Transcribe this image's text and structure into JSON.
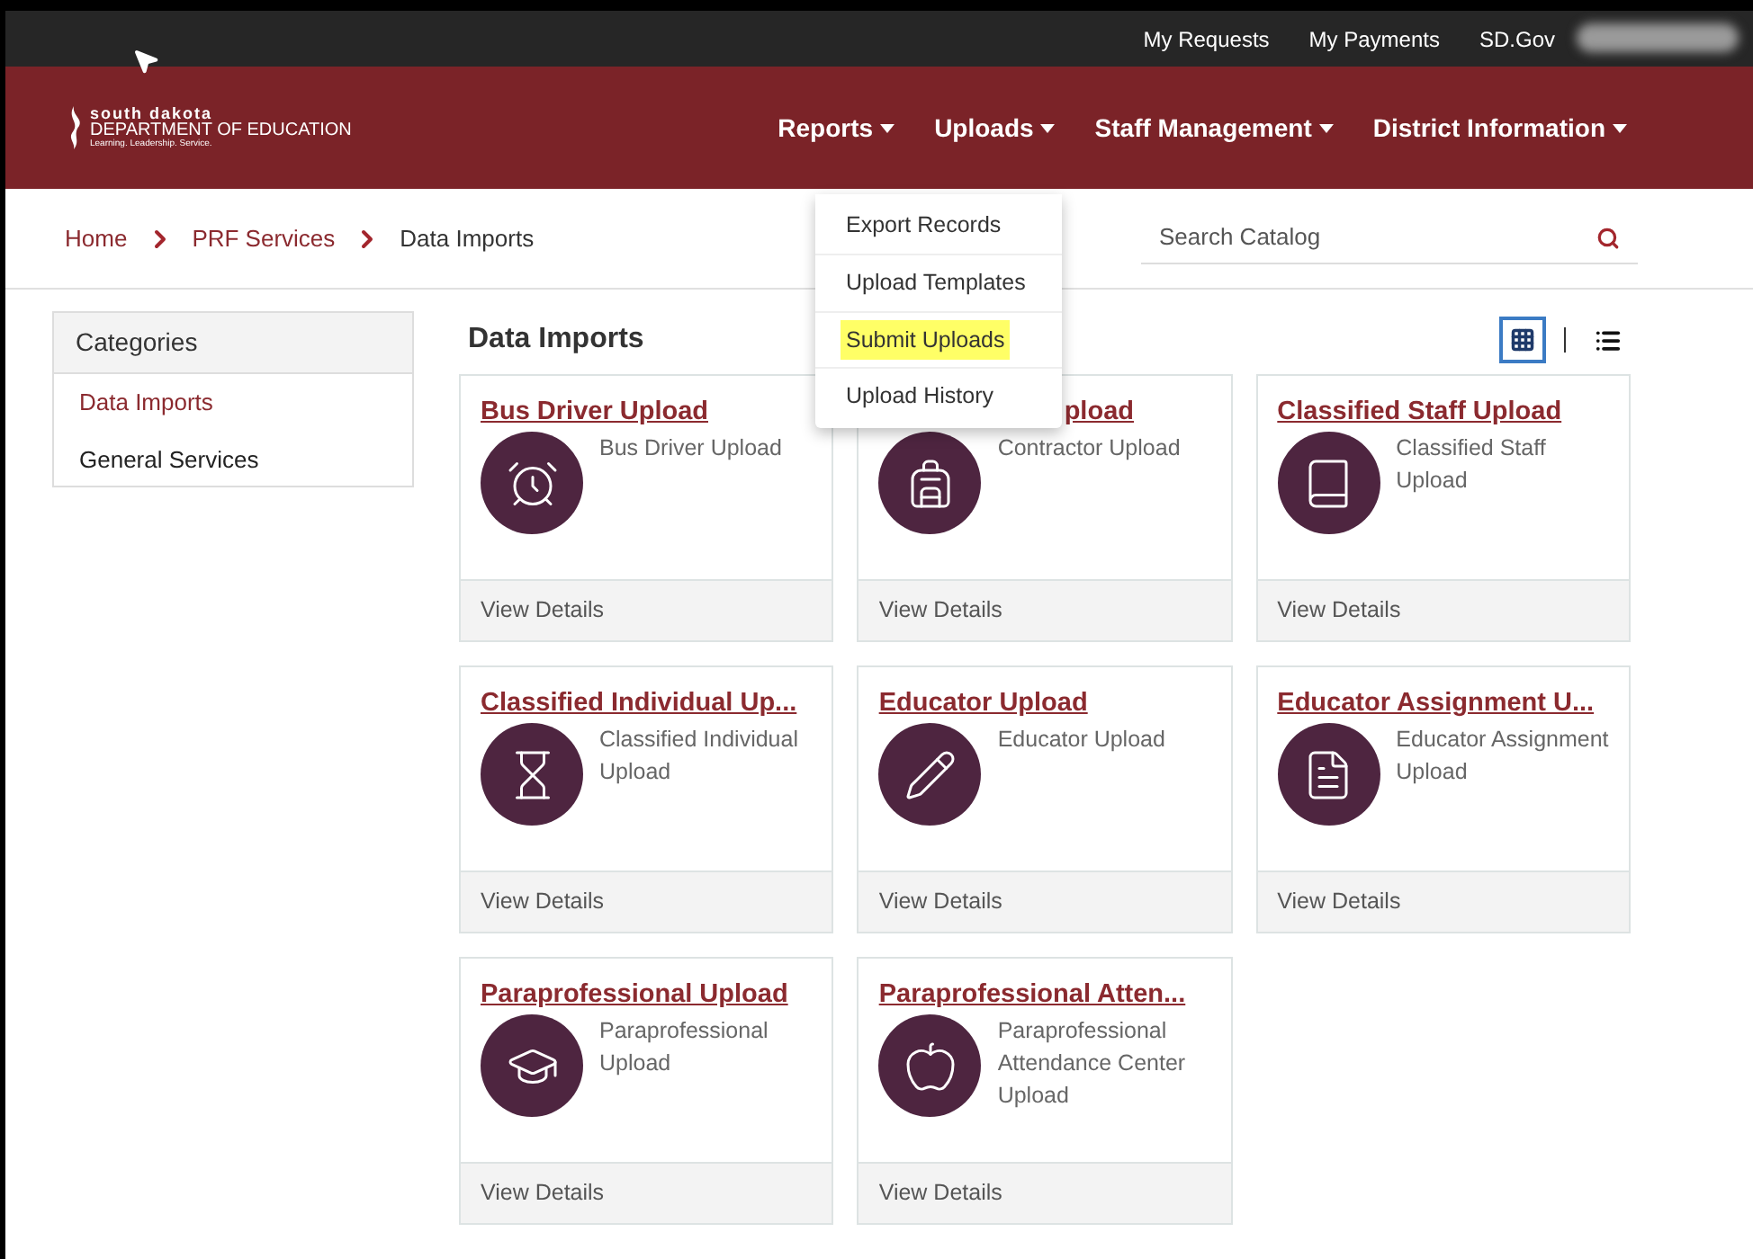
{
  "top_links": [
    "My Requests",
    "My Payments",
    "SD.Gov"
  ],
  "logo": {
    "line_1": "south dakota",
    "line_2": "DEPARTMENT OF EDUCATION",
    "line_3": "Learning. Leadership. Service."
  },
  "nav": [
    "Reports",
    "Uploads",
    "Staff Management",
    "District Information"
  ],
  "dropdown": [
    {
      "label": "Export Records",
      "selected": false
    },
    {
      "label": "Upload Templates",
      "selected": false
    },
    {
      "label": "Submit Uploads",
      "selected": true
    },
    {
      "label": "Upload History",
      "selected": false
    }
  ],
  "breadcrumb": [
    "Home",
    "PRF Services",
    "Data Imports"
  ],
  "search": {
    "placeholder": "Search Catalog"
  },
  "categories": {
    "title": "Categories",
    "items": [
      {
        "label": "Data Imports",
        "selected": true
      },
      {
        "label": "General Services",
        "selected": false
      }
    ]
  },
  "section_title": "Data Imports",
  "view_toggle": {
    "grid_selected": true
  },
  "cards": [
    {
      "title": "Bus Driver Upload",
      "description": "Bus Driver Upload",
      "footer": "View Details",
      "kind": "full"
    },
    {
      "title": "pload",
      "description": "Contractor Upload",
      "footer": "View Details",
      "kind": "occluded"
    },
    {
      "title": "Classified Staff Upload",
      "description": "Classified Staff Upload",
      "footer": "View Details",
      "kind": "full"
    },
    {
      "title": "Classified Individual Up...",
      "description": "Classified Individual Upload",
      "footer": "View Details",
      "kind": "full"
    },
    {
      "title": "Educator Upload",
      "description": "Educator Upload",
      "footer": "View Details",
      "kind": "full"
    },
    {
      "title": "Educator Assignment U...",
      "description": "Educator Assignment Upload",
      "footer": "View Details",
      "kind": "full"
    },
    {
      "title": "Paraprofessional Upload",
      "description": "Paraprofessional Upload",
      "footer": "View Details",
      "kind": "full"
    },
    {
      "title": "Paraprofessional Atten...",
      "description": "Paraprofessional Attendance Center Upload",
      "footer": "View Details",
      "kind": "full"
    }
  ]
}
